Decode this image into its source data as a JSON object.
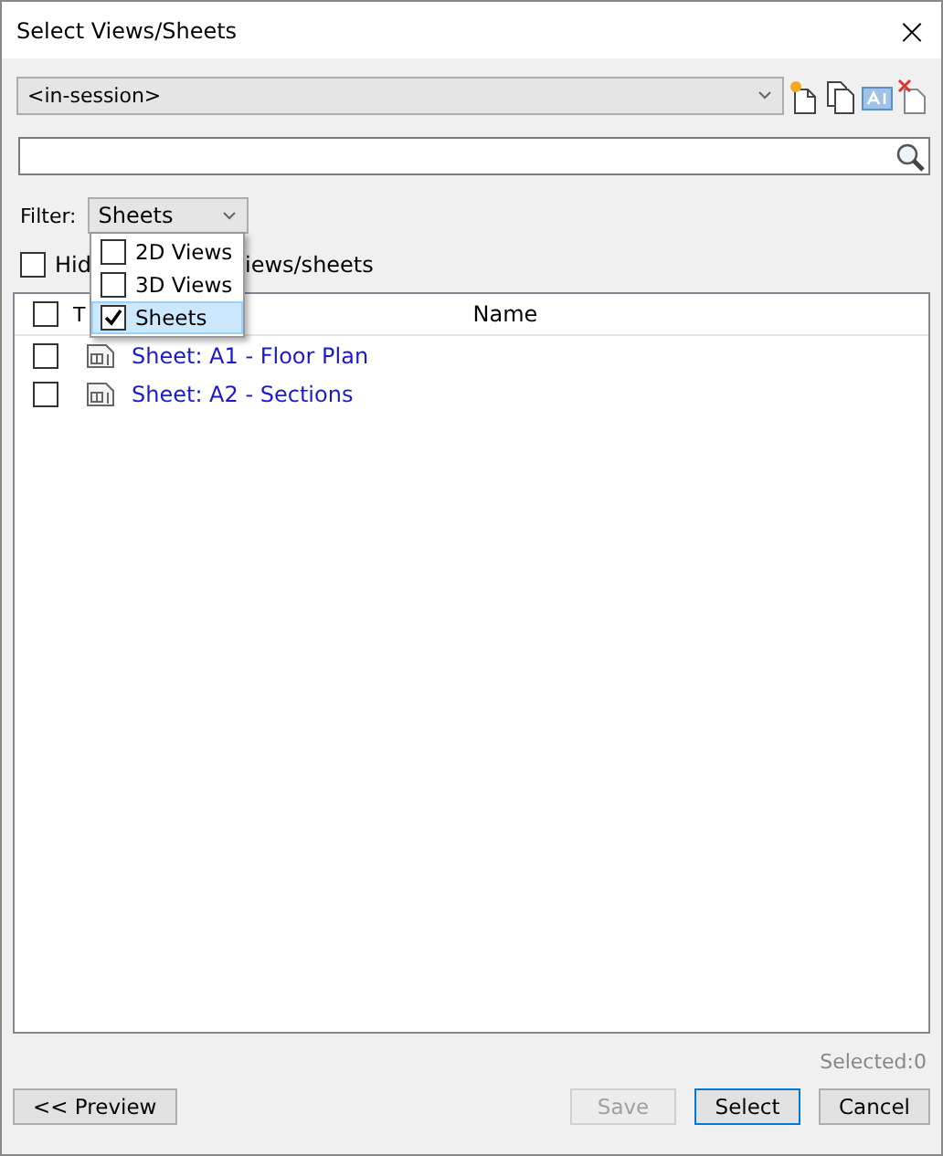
{
  "window": {
    "title": "Select Views/Sheets",
    "close": "×"
  },
  "set_combo": {
    "value": "<in-session>"
  },
  "filter": {
    "label": "Filter:",
    "value": "Sheets",
    "options": [
      {
        "label": "2D Views",
        "checked": false,
        "selected": false
      },
      {
        "label": "3D Views",
        "checked": false,
        "selected": false
      },
      {
        "label": "Sheets",
        "checked": true,
        "selected": true
      }
    ]
  },
  "hide_option": {
    "checked": false,
    "label_start": "Hid",
    "label_end": "iews/sheets"
  },
  "table": {
    "header_checked": false,
    "columns": [
      "T",
      "Name"
    ],
    "rows": [
      {
        "checked": false,
        "name": "Sheet: A1 - Floor Plan"
      },
      {
        "checked": false,
        "name": "Sheet: A2 - Sections"
      }
    ]
  },
  "status": "Selected:0",
  "buttons": [
    {
      "label": "<< Preview",
      "disabled": false,
      "default": false
    },
    {
      "label": "Save",
      "disabled": true,
      "default": false
    },
    {
      "label": "Select",
      "disabled": false,
      "default": true
    },
    {
      "label": "Cancel",
      "disabled": false,
      "default": false
    }
  ]
}
